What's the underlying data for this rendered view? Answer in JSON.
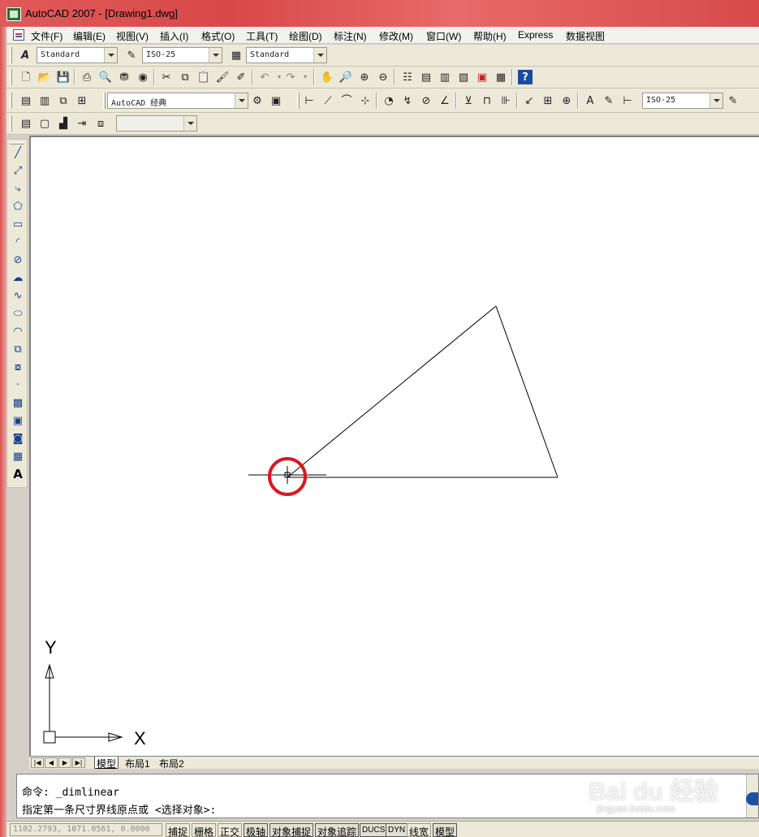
{
  "window": {
    "title": "AutoCAD 2007 - [Drawing1.dwg]"
  },
  "menu": {
    "items": [
      "文件(F)",
      "编辑(E)",
      "视图(V)",
      "插入(I)",
      "格式(O)",
      "工具(T)",
      "绘图(D)",
      "标注(N)",
      "修改(M)",
      "窗口(W)",
      "帮助(H)",
      "Express",
      "数据视图"
    ]
  },
  "styles_toolbar": {
    "text_style": "Standard",
    "dim_style": "ISO-25",
    "table_style": "Standard"
  },
  "standard_toolbar": {
    "icons": [
      "new-icon",
      "open-icon",
      "save-icon",
      "plot-icon",
      "plot-preview-icon",
      "publish-icon",
      "3dwf-icon",
      "cut-icon",
      "copy-icon",
      "paste-icon",
      "match-properties-icon",
      "block-editor-icon",
      "undo-icon",
      "redo-icon",
      "pan-icon",
      "zoom-realtime-icon",
      "zoom-window-icon",
      "zoom-previous-icon",
      "properties-icon",
      "design-center-icon",
      "tool-palettes-icon",
      "sheet-set-icon",
      "markup-icon",
      "quickcalc-icon",
      "help-icon"
    ]
  },
  "workspace_toolbar": {
    "workspace": "AutoCAD 经典",
    "dim_style": "ISO-25"
  },
  "layers_toolbar": {
    "layer": ""
  },
  "draw_toolbar": {
    "icons": [
      "line-icon",
      "construction-line-icon",
      "polyline-icon",
      "polygon-icon",
      "rectangle-icon",
      "arc-icon",
      "circle-icon",
      "revision-cloud-icon",
      "spline-icon",
      "ellipse-icon",
      "ellipse-arc-icon",
      "insert-block-icon",
      "make-block-icon",
      "point-icon",
      "hatch-icon",
      "gradient-icon",
      "region-icon",
      "table-icon",
      "multiline-text-icon"
    ]
  },
  "ucs": {
    "x_label": "X",
    "y_label": "Y"
  },
  "annotation": {
    "color": "#d9181f"
  },
  "layout_tabs": [
    "模型",
    "布局1",
    "布局2"
  ],
  "command": {
    "line1": "命令: _dimlinear",
    "line2": "指定第一条尺寸界线原点或 <选择对象>:"
  },
  "status": {
    "coords": "1102.2793, 1071.0561, 0.0000",
    "buttons": [
      "捕捉",
      "栅格",
      "正交",
      "极轴",
      "对象捕捉",
      "对象追踪",
      "DUCS",
      "DYN",
      "线宽",
      "模型"
    ]
  },
  "watermark": {
    "text": "Bai du 经验",
    "url": "jingyan.baidu.com"
  }
}
